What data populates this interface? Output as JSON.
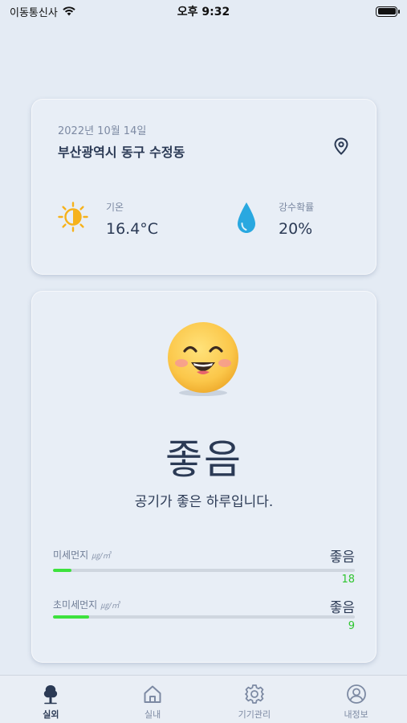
{
  "status_bar": {
    "carrier": "이동통신사",
    "time": "오후 9:32"
  },
  "weather": {
    "date": "2022년 10월 14일",
    "location": "부산광역시 동구 수정동",
    "temperature_label": "기온",
    "temperature_value": "16.4°C",
    "precip_label": "강수확률",
    "precip_value": "20%"
  },
  "air_quality": {
    "grade": "좋음",
    "message": "공기가 좋은 하루입니다.",
    "metrics": [
      {
        "label": "미세먼지",
        "unit": "㎍/㎥",
        "grade": "좋음",
        "value": "18",
        "fill_fraction": 0.06
      },
      {
        "label": "초미세먼지",
        "unit": "㎍/㎥",
        "grade": "좋음",
        "value": "9",
        "fill_fraction": 0.12
      }
    ]
  },
  "tabs": [
    {
      "label": "실외",
      "icon": "tree-icon",
      "active": true
    },
    {
      "label": "실내",
      "icon": "home-icon",
      "active": false
    },
    {
      "label": "기기관리",
      "icon": "gear-icon",
      "active": false
    },
    {
      "label": "내정보",
      "icon": "user-icon",
      "active": false
    }
  ],
  "colors": {
    "background": "#e4ebf4",
    "text_primary": "#2b3a55",
    "good_green": "#3de23d",
    "sun_yellow": "#f6b21b",
    "drop_blue": "#29a8e0"
  }
}
